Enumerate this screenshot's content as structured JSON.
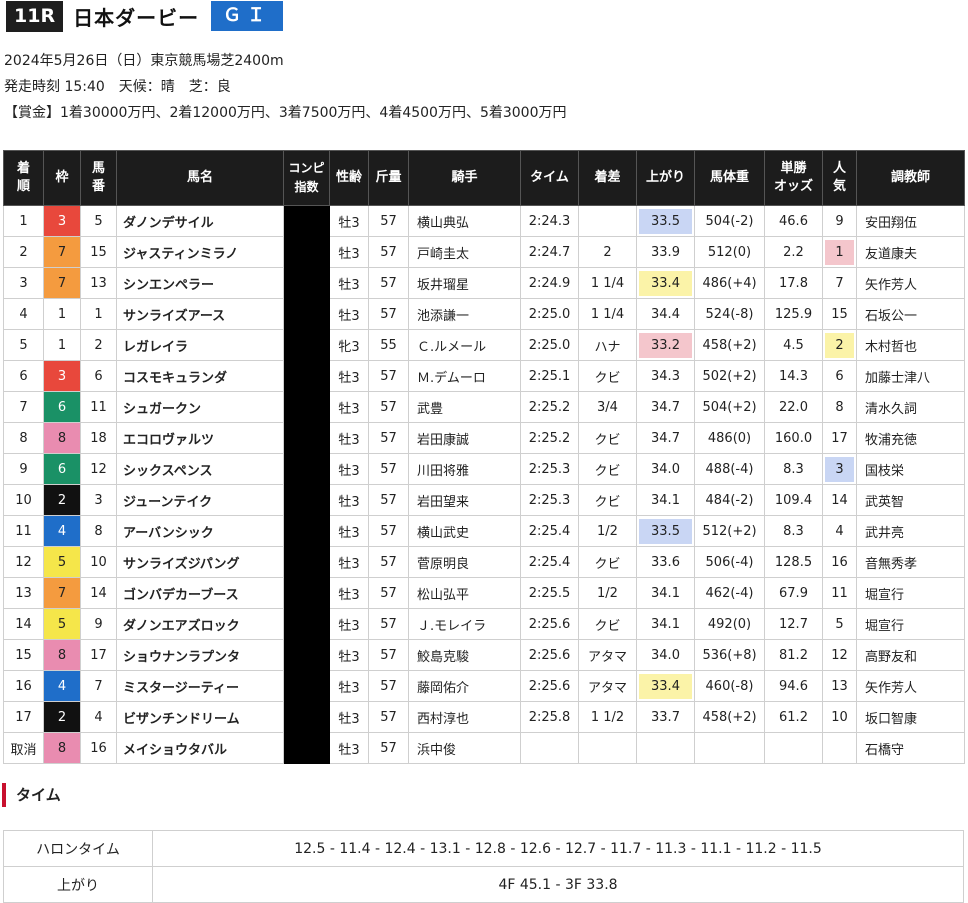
{
  "header": {
    "race_no": "11R",
    "race_name": "日本ダービー",
    "grade": "ＧＩ"
  },
  "info": {
    "line1": "2024年5月26日（日）東京競馬場芝2400m",
    "line2": "発走時刻 15:40　天候：晴　芝：良",
    "line3": "【賞金】1着30000万円、2着12000万円、3着7500万円、4着4500万円、5着3000万円"
  },
  "columns": {
    "rank": "着\n順",
    "frame": "枠",
    "num": "馬\n番",
    "horse": "馬名",
    "compi": "コンピ\n指数",
    "sex_age": "性齢",
    "weight": "斤量",
    "jockey": "騎手",
    "time": "タイム",
    "margin": "着差",
    "last3f": "上がり",
    "body": "馬体重",
    "odds": "単勝\nオッズ",
    "pop": "人\n気",
    "trainer": "調教師"
  },
  "colors": {
    "frame": {
      "1": "#ffffff",
      "2": "#111111",
      "3": "#e8483c",
      "4": "#1f6ec9",
      "5": "#f5e64a",
      "6": "#1a9166",
      "7": "#f49b3f",
      "8": "#e98cb0"
    },
    "last3f": {
      "1": "#f4c6cc",
      "2": "#fbf3a8",
      "3": "#c9d6f4"
    },
    "pop": {
      "1": "#f4c6cc",
      "2": "#fbf3a8",
      "3": "#c9d6f4"
    }
  },
  "rows": [
    {
      "rank": "1",
      "frame": "3",
      "num": "5",
      "horse": "ダノンデサイル",
      "sex_age": "牡3",
      "weight": "57",
      "jockey": "横山典弘",
      "time": "2:24.3",
      "margin": "",
      "last3f": "33.5",
      "last3f_rank": 3,
      "body": "504(-2)",
      "odds": "46.6",
      "pop": "9"
    },
    {
      "rank": "2",
      "frame": "7",
      "num": "15",
      "horse": "ジャスティンミラノ",
      "sex_age": "牡3",
      "weight": "57",
      "jockey": "戸崎圭太",
      "time": "2:24.7",
      "margin": "2",
      "last3f": "33.9",
      "body": "512(0)",
      "odds": "2.2",
      "pop": "1",
      "trainer": "友道康夫"
    },
    {
      "rank": "3",
      "frame": "7",
      "num": "13",
      "horse": "シンエンペラー",
      "sex_age": "牡3",
      "weight": "57",
      "jockey": "坂井瑠星",
      "time": "2:24.9",
      "margin": "1 1/4",
      "last3f": "33.4",
      "last3f_rank": 2,
      "body": "486(+4)",
      "odds": "17.8",
      "pop": "7",
      "trainer": "矢作芳人"
    },
    {
      "rank": "4",
      "frame": "1",
      "num": "1",
      "horse": "サンライズアース",
      "sex_age": "牡3",
      "weight": "57",
      "jockey": "池添謙一",
      "time": "2:25.0",
      "margin": "1 1/4",
      "last3f": "34.4",
      "body": "524(-8)",
      "odds": "125.9",
      "pop": "15",
      "trainer": "石坂公一"
    },
    {
      "rank": "5",
      "frame": "1",
      "num": "2",
      "horse": "レガレイラ",
      "sex_age": "牝3",
      "weight": "55",
      "jockey": "Ｃ.ルメール",
      "time": "2:25.0",
      "margin": "ハナ",
      "last3f": "33.2",
      "last3f_rank": 1,
      "body": "458(+2)",
      "odds": "4.5",
      "pop": "2",
      "trainer": "木村哲也"
    },
    {
      "rank": "6",
      "frame": "3",
      "num": "6",
      "horse": "コスモキュランダ",
      "sex_age": "牡3",
      "weight": "57",
      "jockey": "Ｍ.デムーロ",
      "time": "2:25.1",
      "margin": "クビ",
      "last3f": "34.3",
      "body": "502(+2)",
      "odds": "14.3",
      "pop": "6",
      "trainer": "加藤士津八"
    },
    {
      "rank": "7",
      "frame": "6",
      "num": "11",
      "horse": "シュガークン",
      "sex_age": "牡3",
      "weight": "57",
      "jockey": "武豊",
      "time": "2:25.2",
      "margin": "3/4",
      "last3f": "34.7",
      "body": "504(+2)",
      "odds": "22.0",
      "pop": "8",
      "trainer": "清水久詞"
    },
    {
      "rank": "8",
      "frame": "8",
      "num": "18",
      "horse": "エコロヴァルツ",
      "sex_age": "牡3",
      "weight": "57",
      "jockey": "岩田康誠",
      "time": "2:25.2",
      "margin": "クビ",
      "last3f": "34.7",
      "body": "486(0)",
      "odds": "160.0",
      "pop": "17",
      "trainer": "牧浦充徳"
    },
    {
      "rank": "9",
      "frame": "6",
      "num": "12",
      "horse": "シックスペンス",
      "sex_age": "牡3",
      "weight": "57",
      "jockey": "川田将雅",
      "time": "2:25.3",
      "margin": "クビ",
      "last3f": "34.0",
      "body": "488(-4)",
      "odds": "8.3",
      "pop": "3",
      "trainer": "国枝栄"
    },
    {
      "rank": "10",
      "frame": "2",
      "num": "3",
      "horse": "ジューンテイク",
      "sex_age": "牡3",
      "weight": "57",
      "jockey": "岩田望来",
      "time": "2:25.3",
      "margin": "クビ",
      "last3f": "34.1",
      "body": "484(-2)",
      "odds": "109.4",
      "pop": "14",
      "trainer": "武英智"
    },
    {
      "rank": "11",
      "frame": "4",
      "num": "8",
      "horse": "アーバンシック",
      "sex_age": "牡3",
      "weight": "57",
      "jockey": "横山武史",
      "time": "2:25.4",
      "margin": "1/2",
      "last3f": "33.5",
      "last3f_rank": 3,
      "body": "512(+2)",
      "odds": "8.3",
      "pop": "4",
      "trainer": "武井亮"
    },
    {
      "rank": "12",
      "frame": "5",
      "num": "10",
      "horse": "サンライズジパング",
      "sex_age": "牡3",
      "weight": "57",
      "jockey": "菅原明良",
      "time": "2:25.4",
      "margin": "クビ",
      "last3f": "33.6",
      "body": "506(-4)",
      "odds": "128.5",
      "pop": "16",
      "trainer": "音無秀孝"
    },
    {
      "rank": "13",
      "frame": "7",
      "num": "14",
      "horse": "ゴンバデカーブース",
      "sex_age": "牡3",
      "weight": "57",
      "jockey": "松山弘平",
      "time": "2:25.5",
      "margin": "1/2",
      "last3f": "34.1",
      "body": "462(-4)",
      "odds": "67.9",
      "pop": "11",
      "trainer": "堀宣行"
    },
    {
      "rank": "14",
      "frame": "5",
      "num": "9",
      "horse": "ダノンエアズロック",
      "sex_age": "牡3",
      "weight": "57",
      "jockey": "Ｊ.モレイラ",
      "time": "2:25.6",
      "margin": "クビ",
      "last3f": "34.1",
      "body": "492(0)",
      "odds": "12.7",
      "pop": "5",
      "trainer": "堀宣行"
    },
    {
      "rank": "15",
      "frame": "8",
      "num": "17",
      "horse": "ショウナンラプンタ",
      "sex_age": "牡3",
      "weight": "57",
      "jockey": "鮫島克駿",
      "time": "2:25.6",
      "margin": "アタマ",
      "last3f": "34.0",
      "body": "536(+8)",
      "odds": "81.2",
      "pop": "12",
      "trainer": "高野友和"
    },
    {
      "rank": "16",
      "frame": "4",
      "num": "7",
      "horse": "ミスタージーティー",
      "sex_age": "牡3",
      "weight": "57",
      "jockey": "藤岡佑介",
      "time": "2:25.6",
      "margin": "アタマ",
      "last3f": "33.4",
      "last3f_rank": 2,
      "body": "460(-8)",
      "odds": "94.6",
      "pop": "13",
      "trainer": "矢作芳人"
    },
    {
      "rank": "17",
      "frame": "2",
      "num": "4",
      "horse": "ビザンチンドリーム",
      "sex_age": "牡3",
      "weight": "57",
      "jockey": "西村淳也",
      "time": "2:25.8",
      "margin": "1 1/2",
      "last3f": "33.7",
      "body": "458(+2)",
      "odds": "61.2",
      "pop": "10",
      "trainer": "坂口智康"
    },
    {
      "rank": "取消",
      "frame": "8",
      "num": "16",
      "horse": "メイショウタバル",
      "sex_age": "牡3",
      "weight": "57",
      "jockey": "浜中俊",
      "time": "",
      "margin": "",
      "last3f": "",
      "body": "",
      "odds": "",
      "pop": "",
      "trainer": "石橋守"
    }
  ],
  "first_row_trainer": "安田翔伍",
  "section_time": {
    "title": "タイム",
    "halon_label": "ハロンタイム",
    "halon": "12.5 - 11.4 - 12.4 - 13.1 - 12.8 - 12.6 - 12.7 - 11.7 - 11.3 - 11.1 - 11.2 - 11.5",
    "agari_label": "上がり",
    "agari": "4F 45.1 - 3F 33.8"
  }
}
